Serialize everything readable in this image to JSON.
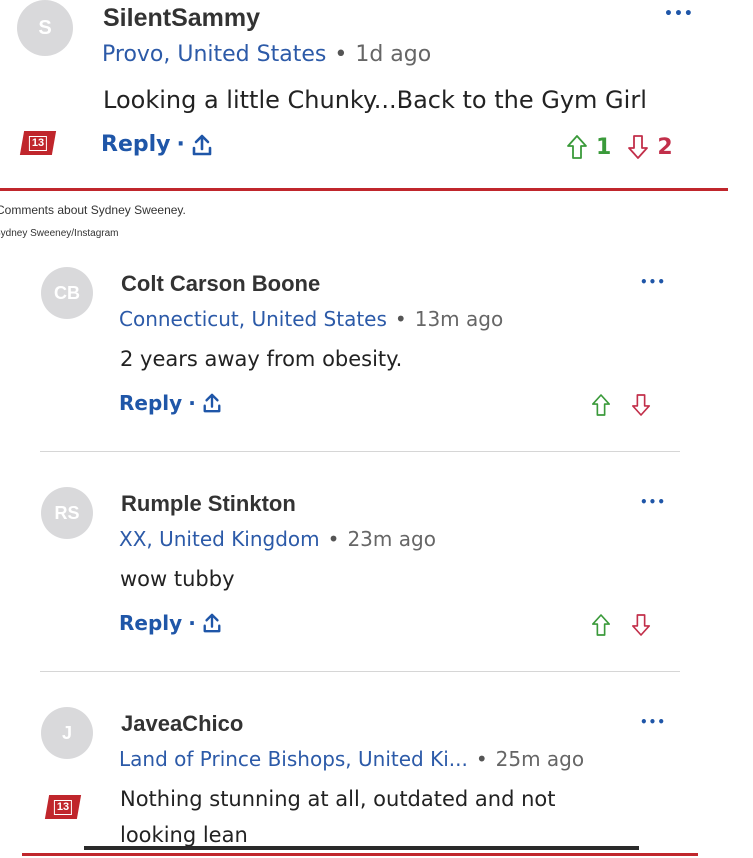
{
  "badge_text": "13",
  "top_comment": {
    "avatar_initials": "S",
    "username": "SilentSammy",
    "location": "Provo, United States",
    "dot": "•",
    "time": "1d ago",
    "text": "Looking a little Chunky...Back to the Gym Girl",
    "reply_label": "Reply",
    "upvotes": "1",
    "downvotes": "2",
    "more": "•••"
  },
  "caption": {
    "line1": "Comments about Sydney Sweeney.",
    "line2": "Sydney Sweeney/Instagram"
  },
  "comments": [
    {
      "avatar_initials": "CB",
      "username": "Colt Carson Boone",
      "location": "Connecticut, United States",
      "dot": "•",
      "time": "13m ago",
      "text": "2 years away from obesity.",
      "reply_label": "Reply",
      "more": "•••"
    },
    {
      "avatar_initials": "RS",
      "username": "Rumple Stinkton",
      "location": "XX, United Kingdom",
      "dot": "•",
      "time": "23m ago",
      "text": "wow tubby",
      "reply_label": "Reply",
      "more": "•••"
    },
    {
      "avatar_initials": "J",
      "username": "JaveaChico",
      "location": "Land of Prince Bishops, United Ki...",
      "dot": "•",
      "time": "25m ago",
      "text_line1": "Nothing stunning at all, outdated and not",
      "text_line2": "looking lean",
      "more": "•••"
    }
  ],
  "colors": {
    "accent_red": "#c0262c",
    "link_blue": "#1f56a8",
    "upvote_green": "#3a9a3a",
    "downvote_red": "#c22f4a"
  }
}
